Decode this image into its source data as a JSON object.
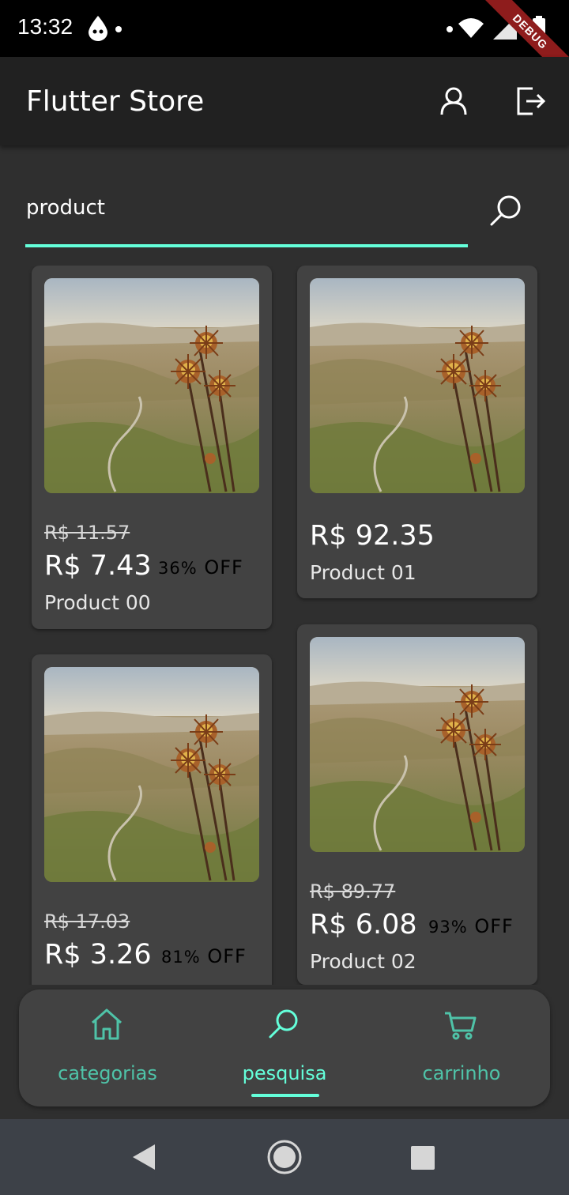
{
  "status": {
    "time": "13:32",
    "debug_label": "DEBUG"
  },
  "app_bar": {
    "title": "Flutter Store"
  },
  "search": {
    "value": "product"
  },
  "products": [
    {
      "old_price": "R$ 11.57",
      "price": "R$ 7.43",
      "discount_num": "36%",
      "discount_text": "OFF",
      "name": "Product 00"
    },
    {
      "old_price": "",
      "price": "R$ 92.35",
      "discount_num": "",
      "discount_text": "",
      "name": "Product 01"
    },
    {
      "old_price": "R$ 17.03",
      "price": "R$ 3.26",
      "discount_num": "81%",
      "discount_text": "OFF",
      "name": ""
    },
    {
      "old_price": "R$ 89.77",
      "price": "R$ 6.08",
      "discount_num": "93%",
      "discount_text": "OFF",
      "name": "Product 02"
    }
  ],
  "bottom_nav": {
    "items": [
      {
        "label": "categorias",
        "icon": "home-icon"
      },
      {
        "label": "pesquisa",
        "icon": "search-icon",
        "active": true
      },
      {
        "label": "carrinho",
        "icon": "cart-icon"
      }
    ]
  },
  "colors": {
    "accent": "#64ffda",
    "app_bar": "#212121",
    "background": "#2f2f2f",
    "card": "#424242"
  }
}
